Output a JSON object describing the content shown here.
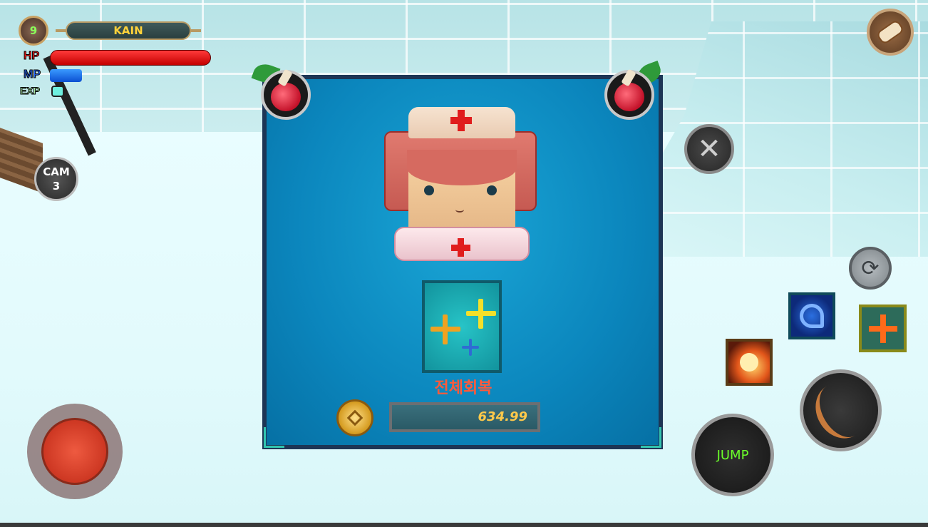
{
  "player": {
    "level": "9",
    "name": "KAIN",
    "hp_label": "HP",
    "mp_label": "MP",
    "exp_label": "EXP",
    "hp_fraction": 1.0,
    "mp_fraction": 0.2,
    "exp_fraction": 0.08
  },
  "camera": {
    "label": "CAM",
    "number": "3"
  },
  "shop": {
    "item_name": "전체회복",
    "price": "634.99",
    "left_icon": "red-potion-icon",
    "right_icon": "red-potion-icon",
    "item_icon": "triple-plus-icon"
  },
  "controls": {
    "close_symbol": "✕",
    "swap_symbol": "⟳",
    "jump_label": "JUMP",
    "skills": [
      "fireball-skill-icon",
      "dragon-skill-icon",
      "heal-plus-skill-icon"
    ]
  },
  "colors": {
    "hp": "#e51919",
    "mp": "#1a5fe6",
    "exp": "#6ff0e0",
    "panel": "#0b86bd",
    "item_name": "#ff5a3a",
    "price": "#ffc94a",
    "jump_text": "#6bff2a"
  }
}
